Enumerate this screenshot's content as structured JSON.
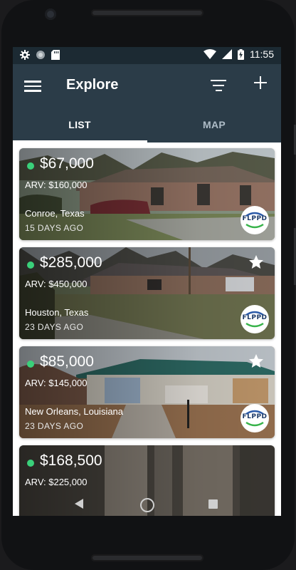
{
  "status_bar": {
    "time": "11:55",
    "icons": [
      "gear-icon",
      "circle-icon",
      "sd-card-icon",
      "wifi-icon",
      "signal-icon",
      "battery-charging-icon"
    ]
  },
  "app_bar": {
    "title": "Explore",
    "menu_icon": "hamburger-menu-icon",
    "filter_icon": "filter-icon",
    "add_icon": "plus-icon"
  },
  "tabs": [
    {
      "label": "LIST",
      "active": true
    },
    {
      "label": "MAP",
      "active": false
    }
  ],
  "listings": [
    {
      "price": "$67,000",
      "arv": "ARV: $160,000",
      "location": "Conroe, Texas",
      "posted": "15 DAYS AGO",
      "starred": false,
      "logo_text": "FLPPD"
    },
    {
      "price": "$285,000",
      "arv": "ARV: $450,000",
      "location": "Houston, Texas",
      "posted": "23 DAYS AGO",
      "starred": true,
      "logo_text": "FLPPD"
    },
    {
      "price": "$85,000",
      "arv": "ARV: $145,000",
      "location": "New Orleans, Louisiana",
      "posted": "23 DAYS AGO",
      "starred": true,
      "logo_text": "FLPPD"
    },
    {
      "price": "$168,500",
      "arv": "ARV: $225,000",
      "location": "",
      "posted": "",
      "starred": false,
      "logo_text": ""
    }
  ],
  "colors": {
    "app_bar": "#2b3c48",
    "status_bar": "#1c2a33",
    "active_dot": "#3ad07a",
    "logo_text": "#1d3a68"
  },
  "nav_bar": {
    "icons": [
      "back-icon",
      "home-icon",
      "recents-icon"
    ]
  }
}
